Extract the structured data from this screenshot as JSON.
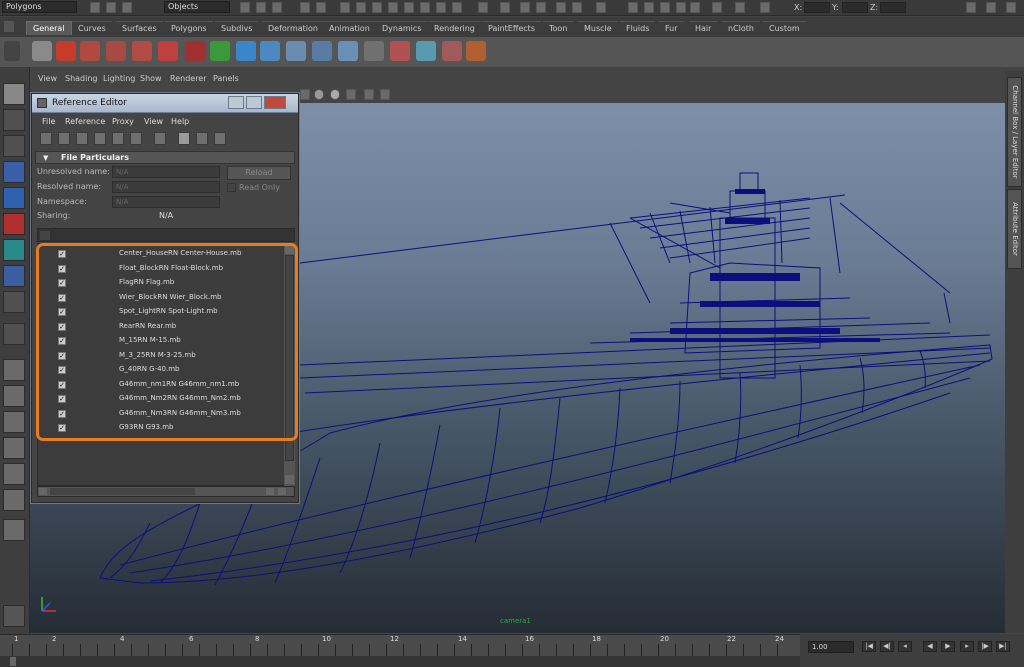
{
  "status_line": {
    "mode_menu": "Polygons",
    "selection_mask": "Objects",
    "x_label": "X:",
    "y_label": "Y:",
    "z_label": "Z:"
  },
  "shelf_tabs": [
    "General",
    "Curves",
    "Surfaces",
    "Polygons",
    "Subdivs",
    "Deformation",
    "Animation",
    "Dynamics",
    "Rendering",
    "PaintEffects",
    "Toon",
    "Muscle",
    "Fluids",
    "Fur",
    "Hair",
    "nCloth",
    "Custom"
  ],
  "viewport": {
    "menu": [
      "View",
      "Shading",
      "Lighting",
      "Show",
      "Renderer",
      "Panels"
    ],
    "camera_label": "camera1"
  },
  "right_panel": {
    "tab1": "Channel Box / Layer Editor",
    "tab2": "Attribute Editor"
  },
  "reference_editor": {
    "title": "Reference Editor",
    "menu": [
      "File",
      "Reference",
      "Proxy",
      "View",
      "Help"
    ],
    "section_title": "File Particulars",
    "unresolved_label": "Unresolved name:",
    "unresolved_value": "N/A",
    "resolved_label": "Resolved name:",
    "resolved_value": "N/A",
    "namespace_label": "Namespace:",
    "namespace_value": "N/A",
    "sharing_label": "Sharing:",
    "sharing_value": "N/A",
    "reload_label": "Reload",
    "readonly_label": "Read Only",
    "references": [
      "Center_HouseRN Center-House.mb",
      "Float_BlockRN Float-Block.mb",
      "FlagRN Flag.mb",
      "Wier_BlockRN Wier_Block.mb",
      "Spot_LightRN Spot-Light.mb",
      "RearRN Rear.mb",
      "M_15RN M-15.mb",
      "M_3_25RN M-3-25.mb",
      "G_40RN G-40.mb",
      "G46mm_nm1RN G46mm_nm1.mb",
      "G46mm_Nm2RN G46mm_Nm2.mb",
      "G46mm_Nm3RN G46mm_Nm3.mb",
      "G93RN G93.mb"
    ],
    "check_mark": "✓"
  },
  "time_slider": {
    "ticks": [
      "1",
      "2",
      "4",
      "6",
      "8",
      "10",
      "12",
      "14",
      "16",
      "18",
      "20",
      "22",
      "24"
    ],
    "current_frame": "1.00"
  },
  "colors": {
    "highlight": "#e87b1d",
    "wireframe": "#0b0f7c"
  }
}
